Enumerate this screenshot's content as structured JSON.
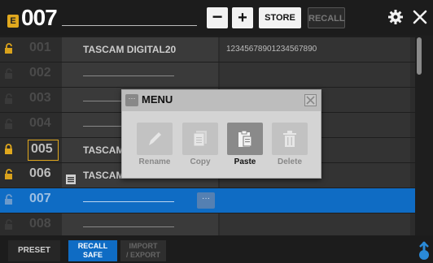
{
  "header": {
    "badge": "E",
    "scene_number": "007",
    "minus_label": "−",
    "plus_label": "+",
    "store_label": "STORE",
    "recall_label": "RECALL",
    "settings_icon": "gear-icon",
    "close_icon": "close-icon"
  },
  "scenes": [
    {
      "number": "001",
      "name": "TASCAM DIGITAL20",
      "comment": "12345678901234567890",
      "locked": true,
      "lock_visible": true
    },
    {
      "number": "002",
      "name": "",
      "comment": "",
      "locked": false,
      "lock_visible": false
    },
    {
      "number": "003",
      "name": "",
      "comment": "",
      "locked": false,
      "lock_visible": false
    },
    {
      "number": "004",
      "name": "",
      "comment": "",
      "locked": false,
      "lock_visible": false
    },
    {
      "number": "005",
      "name": "TASCAM",
      "comment": "",
      "locked": true,
      "lock_visible": true
    },
    {
      "number": "006",
      "name": "TASCAM",
      "comment": "",
      "locked": true,
      "lock_visible": true
    },
    {
      "number": "007",
      "name": "",
      "comment": "",
      "locked": false,
      "lock_visible": true,
      "selected": true
    },
    {
      "number": "008",
      "name": "",
      "comment": "",
      "locked": false,
      "lock_visible": false
    }
  ],
  "menu": {
    "title": "MENU",
    "items": [
      {
        "label": "Rename",
        "icon": "pencil-icon",
        "enabled": false
      },
      {
        "label": "Copy",
        "icon": "copy-icon",
        "enabled": false
      },
      {
        "label": "Paste",
        "icon": "paste-icon",
        "enabled": true
      },
      {
        "label": "Delete",
        "icon": "trash-icon",
        "enabled": false
      }
    ]
  },
  "footer": {
    "preset_label": "PRESET",
    "recall_safe_line1": "RECALL",
    "recall_safe_line2": "SAFE",
    "import_export_line1": "IMPORT",
    "import_export_line2": "/ EXPORT"
  },
  "colors": {
    "accent_yellow": "#e0a81e",
    "selection_blue": "#0f6cc4"
  }
}
